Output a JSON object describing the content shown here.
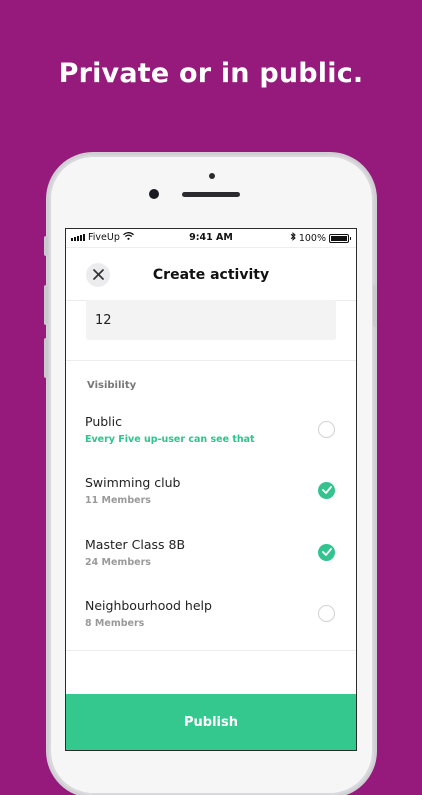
{
  "headline": "Private or in public.",
  "status_bar": {
    "carrier": "FiveUp",
    "time": "9:41 AM",
    "battery": "100%",
    "wifi_icon": "wifi-icon",
    "bluetooth_icon": "bluetooth-icon"
  },
  "nav": {
    "title": "Create activity",
    "close_icon": "close-icon"
  },
  "input": {
    "value": "12"
  },
  "visibility": {
    "label": "Visibility",
    "options": [
      {
        "title": "Public",
        "subtitle": "Every Five up-user can see that",
        "selected": false
      },
      {
        "title": "Swimming club",
        "subtitle": "11 Members",
        "selected": true
      },
      {
        "title": "Master Class 8B",
        "subtitle": "24 Members",
        "selected": true
      },
      {
        "title": "Neighbourhood help",
        "subtitle": "8 Members",
        "selected": false
      }
    ]
  },
  "publish_label": "Publish",
  "colors": {
    "background": "#951a7c",
    "accent": "#34c88e",
    "public_subtitle": "#2ec48d"
  }
}
